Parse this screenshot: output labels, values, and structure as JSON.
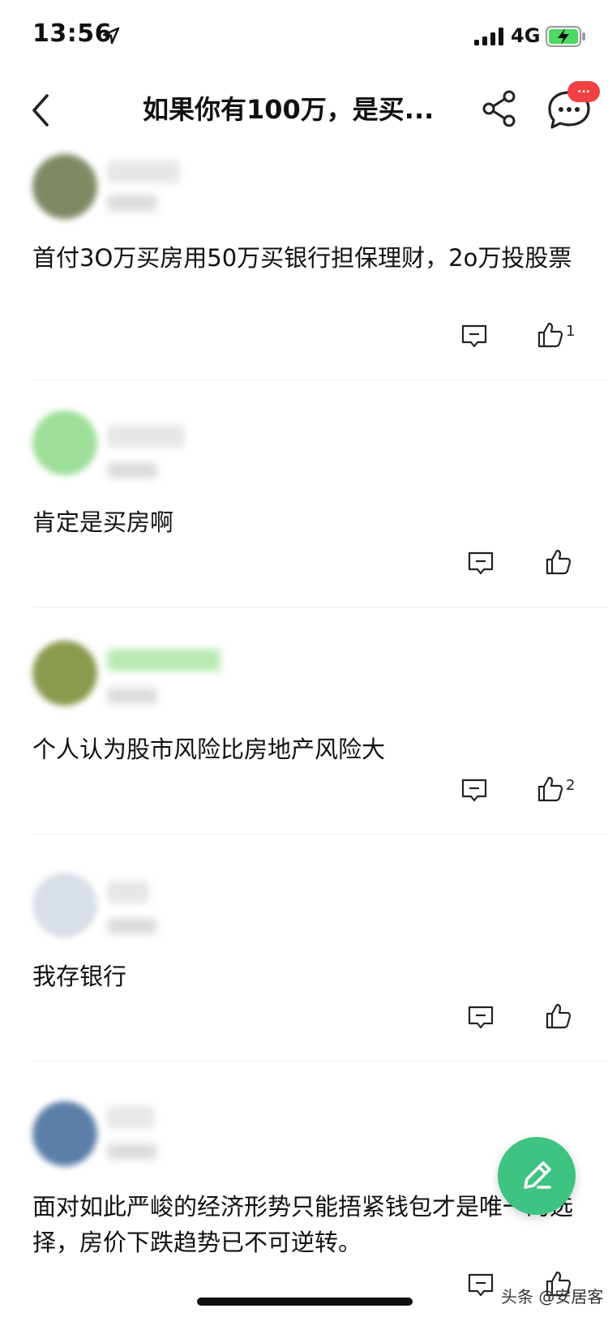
{
  "status_bar": {
    "time": "13:56",
    "network": "4G"
  },
  "nav": {
    "title": "如果你有100万，是买...",
    "badge_text": "..."
  },
  "comments": [
    {
      "text": "首付3O万买房用50万买银行担保理财，2o万投股票",
      "likes": "1",
      "avatar_color": "#7d8a64",
      "name_color": "#e6e6e6"
    },
    {
      "text": "肯定是买房啊",
      "likes": "",
      "avatar_color": "#9ddf98",
      "name_color": "#e6e6e6"
    },
    {
      "text": "个人认为股市风险比房地产风险大",
      "likes": "2",
      "avatar_color": "#8a9a4e",
      "name_color": "#b9eab3"
    },
    {
      "text": "我存银行",
      "likes": "",
      "avatar_color": "#d9dfe7",
      "name_color": "#e6e6e6"
    },
    {
      "text": "面对如此严峻的经济形势只能捂紧钱包才是唯一的选择，房价下跌趋势已不可逆转。",
      "likes": "",
      "avatar_color": "#5b7fa8",
      "name_color": "#e6e6e6"
    }
  ],
  "colors": {
    "accent_green": "#3fc383",
    "badge_red": "#f04142"
  },
  "watermark": "头条 @安居客"
}
